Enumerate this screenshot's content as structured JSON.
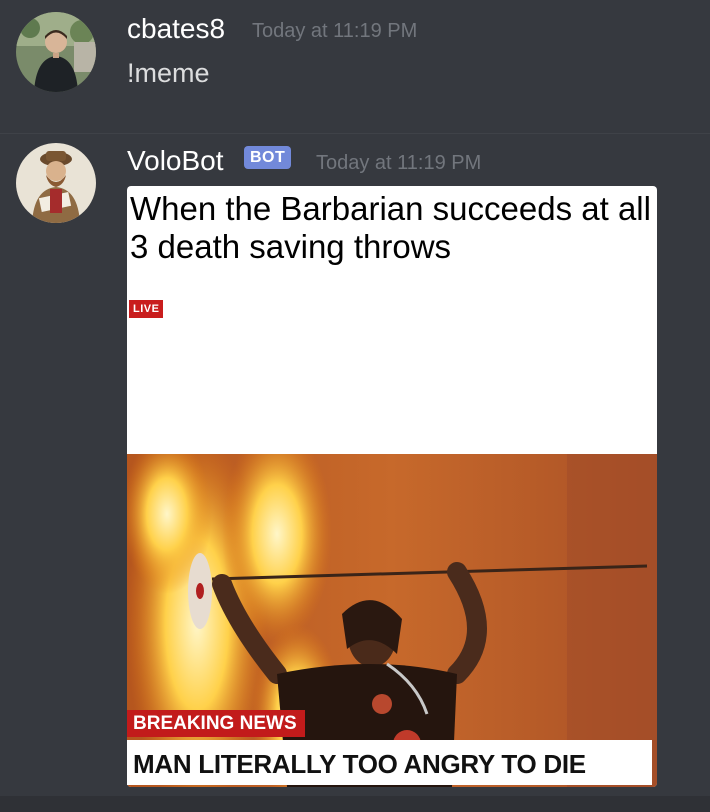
{
  "messages": [
    {
      "username": "cbates8",
      "timestamp": "Today at 11:19 PM",
      "content": "!meme"
    },
    {
      "username": "VoloBot",
      "badge": "BOT",
      "timestamp": "Today at 11:19 PM",
      "embed": {
        "caption": "When the Barbarian succeeds at all 3 death saving throws",
        "live_label": "LIVE",
        "breaking_label": "BREAKING NEWS",
        "headline": "MAN LITERALLY TOO ANGRY TO DIE"
      }
    }
  ],
  "colors": {
    "background": "#36393f",
    "username": "#ffffff",
    "timestamp": "#72767d",
    "text": "#dcddde",
    "bot_badge": "#7289da",
    "news_red": "#c21b1b"
  }
}
